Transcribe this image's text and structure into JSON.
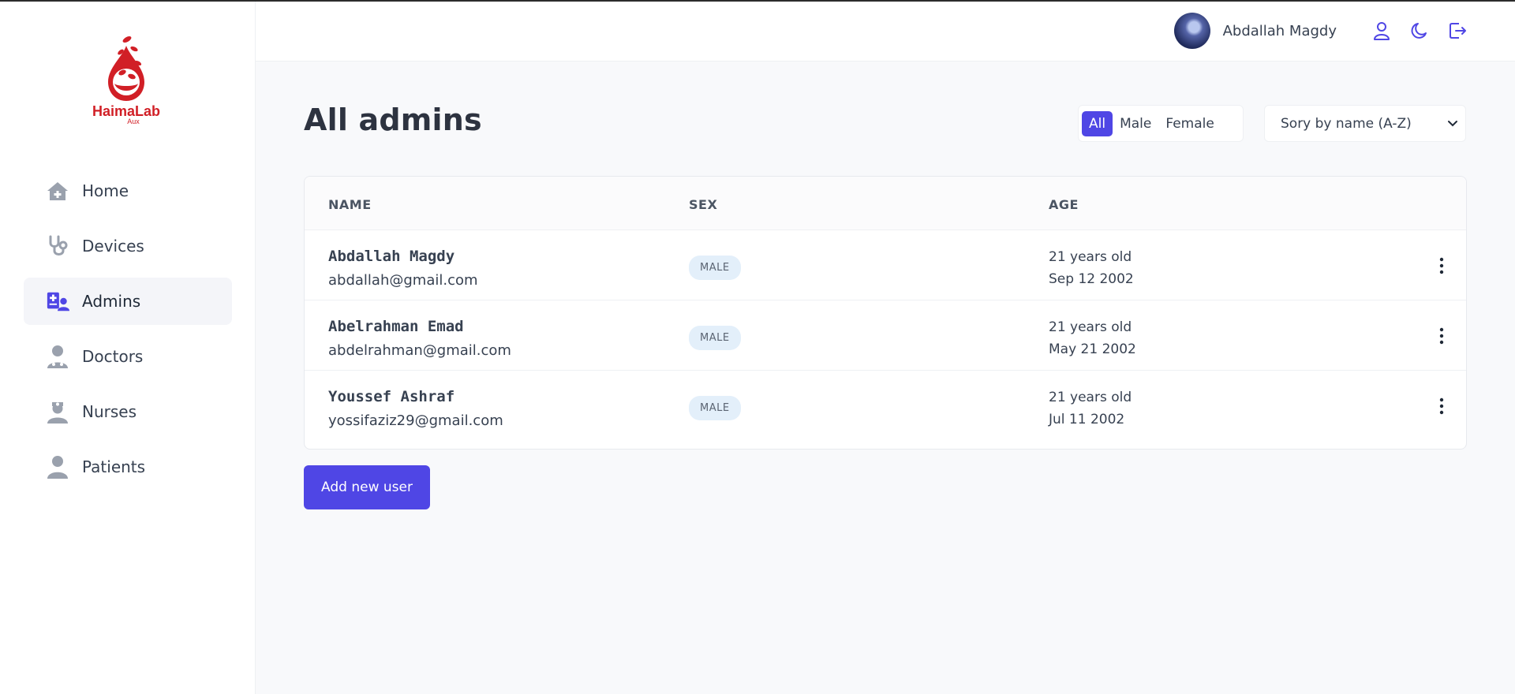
{
  "app": {
    "logo_name": "HaimaLab",
    "logo_sub": "Aux"
  },
  "sidebar": {
    "items": [
      {
        "label": "Home",
        "icon": "home-icon"
      },
      {
        "label": "Devices",
        "icon": "stethoscope-icon"
      },
      {
        "label": "Admins",
        "icon": "admin-icon",
        "active": true
      },
      {
        "label": "Doctors",
        "icon": "doctor-icon"
      },
      {
        "label": "Nurses",
        "icon": "nurse-icon"
      },
      {
        "label": "Patients",
        "icon": "patient-icon"
      }
    ]
  },
  "header": {
    "user_name": "Abdallah Magdy",
    "icons": [
      "user-icon",
      "moon-icon",
      "logout-icon"
    ]
  },
  "main": {
    "title": "All admins",
    "filters": [
      "All",
      "Male",
      "Female"
    ],
    "active_filter": "All",
    "sort_label": "Sory by name (A-Z)",
    "columns": [
      "NAME",
      "SEX",
      "AGE"
    ],
    "rows": [
      {
        "name": "Abdallah Magdy",
        "email": "abdallah@gmail.com",
        "sex": "MALE",
        "age": "21 years old",
        "dob": "Sep 12 2002"
      },
      {
        "name": "Abelrahman Emad",
        "email": "abdelrahman@gmail.com",
        "sex": "MALE",
        "age": "21 years old",
        "dob": "May 21 2002"
      },
      {
        "name": "Youssef Ashraf",
        "email": "yossifaziz29@gmail.com",
        "sex": "MALE",
        "age": "21 years old",
        "dob": "Jul 11 2002"
      }
    ],
    "add_button": "Add new user"
  },
  "colors": {
    "accent": "#4f46e5",
    "brand": "#d11f26",
    "badge_bg": "#e3effa"
  }
}
